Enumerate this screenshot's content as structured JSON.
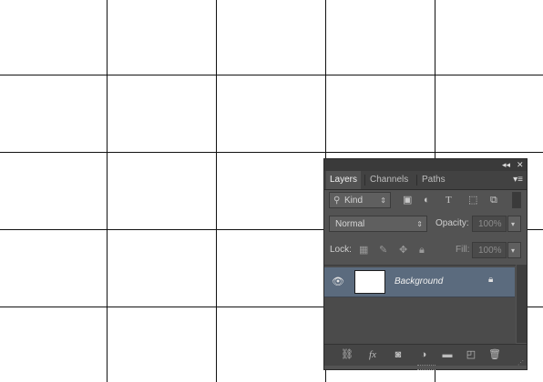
{
  "panel": {
    "title_collapse_icon": "collapse-icon",
    "close_icon": "close-icon",
    "menu_icon": "panel-menu-icon",
    "tabs": [
      {
        "label": "Layers",
        "active": true
      },
      {
        "label": "Channels",
        "active": false
      },
      {
        "label": "Paths",
        "active": false
      }
    ],
    "filter": {
      "kind_label": "Kind",
      "icons": [
        "search-icon",
        "image-filter-icon",
        "adjustment-filter-icon",
        "type-filter-icon",
        "shape-filter-icon",
        "smart-object-filter-icon",
        "filter-toggle-icon"
      ]
    },
    "blend": {
      "mode": "Normal",
      "opacity_label": "Opacity:",
      "opacity_value": "100%"
    },
    "lock": {
      "label": "Lock:",
      "icons": [
        "lock-transparent-icon",
        "lock-image-icon",
        "lock-position-icon",
        "lock-all-icon"
      ],
      "fill_label": "Fill:",
      "fill_value": "100%"
    },
    "layers": [
      {
        "name": "Background",
        "visible": true,
        "locked": true,
        "selected": true
      }
    ],
    "footer_icons": [
      "link-layers-icon",
      "fx-icon",
      "add-mask-icon",
      "adjustment-layer-icon",
      "group-folder-icon",
      "new-layer-icon",
      "trash-icon"
    ]
  }
}
